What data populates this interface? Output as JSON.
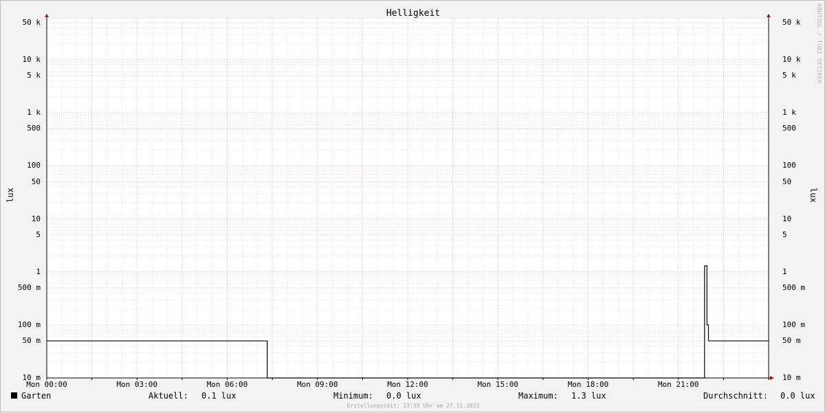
{
  "chart_data": {
    "type": "line",
    "title": "Helligkeit",
    "ylabel": "lux",
    "yscale": "log",
    "ylim": [
      0.01,
      60000
    ],
    "xlim_hours": [
      0,
      24
    ],
    "x_ticks": [
      {
        "h": 0,
        "label": "Mon 00:00"
      },
      {
        "h": 3,
        "label": "Mon 03:00"
      },
      {
        "h": 6,
        "label": "Mon 06:00"
      },
      {
        "h": 9,
        "label": "Mon 09:00"
      },
      {
        "h": 12,
        "label": "Mon 12:00"
      },
      {
        "h": 15,
        "label": "Mon 15:00"
      },
      {
        "h": 18,
        "label": "Mon 18:00"
      },
      {
        "h": 21,
        "label": "Mon 21:00"
      }
    ],
    "y_ticks": [
      {
        "v": 50000,
        "label": "50 k"
      },
      {
        "v": 10000,
        "label": "10 k"
      },
      {
        "v": 5000,
        "label": "5 k"
      },
      {
        "v": 1000,
        "label": "1 k"
      },
      {
        "v": 500,
        "label": "500"
      },
      {
        "v": 100,
        "label": "100"
      },
      {
        "v": 50,
        "label": "50"
      },
      {
        "v": 10,
        "label": "10"
      },
      {
        "v": 5,
        "label": "5"
      },
      {
        "v": 1,
        "label": "1"
      },
      {
        "v": 0.5,
        "label": "500 m"
      },
      {
        "v": 0.1,
        "label": "100 m"
      },
      {
        "v": 0.05,
        "label": "50 m"
      },
      {
        "v": 0.01,
        "label": "10 m"
      }
    ],
    "grid": true,
    "series": [
      {
        "name": "Garten",
        "color": "#000000",
        "step": true,
        "points": [
          [
            0.0,
            0.05
          ],
          [
            7.3,
            0.05
          ],
          [
            7.33,
            0.01
          ],
          [
            21.85,
            0.01
          ],
          [
            21.87,
            1.3
          ],
          [
            21.95,
            0.1
          ],
          [
            22.0,
            0.05
          ],
          [
            24.0,
            0.05
          ]
        ]
      }
    ]
  },
  "legend": {
    "series_name": "Garten",
    "current_label": "Aktuell:",
    "current_value": "0.1 lux",
    "min_label": "Minimum:",
    "min_value": "0.0 lux",
    "max_label": "Maximum:",
    "max_value": "1.3 lux",
    "avg_label": "Durchschnitt:",
    "avg_value": "0.0 lux"
  },
  "watermark": "RRDTOOL / TOBI OETIKER",
  "footer": "Erstellungszeit: 23:55 Uhr am 27.11.2023",
  "colors": {
    "major_grid": "#e8a0a8",
    "minor_grid": "#c8c8c8",
    "axis": "#000000",
    "arrow": "#9b1b1b",
    "plot_bg": "#ffffff",
    "canvas_bg": "#f3f3f3"
  }
}
